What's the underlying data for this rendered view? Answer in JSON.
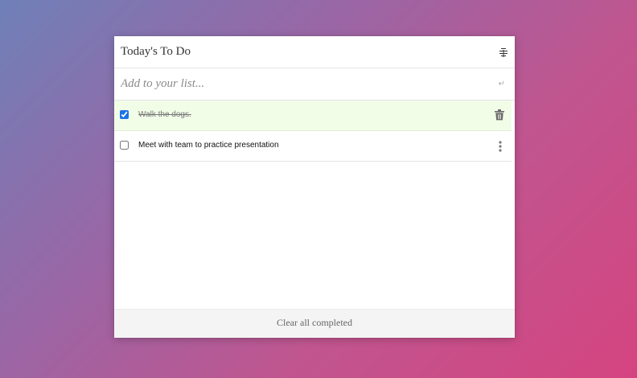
{
  "header": {
    "title": "Today's To Do",
    "filter_icon": "filter-lines-icon"
  },
  "add": {
    "placeholder": "Add to your list...",
    "value": "",
    "enter_icon": "enter-return-icon"
  },
  "items": [
    {
      "label": "Walk the dogs.",
      "completed": true,
      "action_icon": "trash-icon"
    },
    {
      "label": "Meet with team to practice presentation",
      "completed": false,
      "action_icon": "more-vertical-icon"
    }
  ],
  "footer": {
    "clear_label": "Clear all completed"
  },
  "colors": {
    "completed_row": "#f2fde8",
    "checkbox_accent": "#1a73e8",
    "footer_bg": "#f4f4f4"
  }
}
